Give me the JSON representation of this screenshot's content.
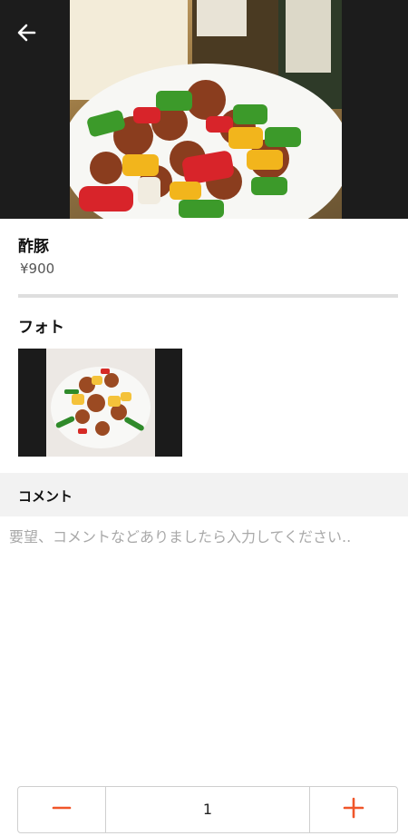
{
  "item": {
    "name": "酢豚",
    "price": "¥900"
  },
  "photos": {
    "title": "フォト"
  },
  "comment": {
    "title": "コメント",
    "placeholder": "要望、コメントなどありましたら入力してください.."
  },
  "quantity": {
    "value": "1"
  },
  "colors": {
    "accent": "#f0562a"
  }
}
